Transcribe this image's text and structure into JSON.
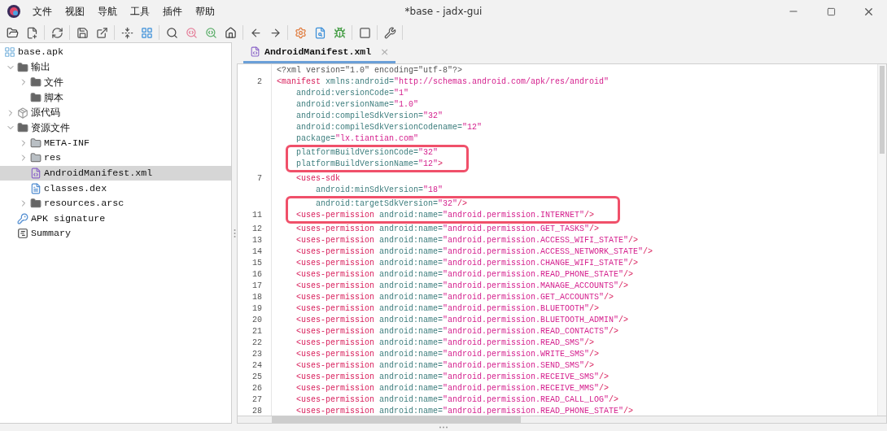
{
  "window": {
    "title": "*base - jadx-gui"
  },
  "menu": [
    "文件",
    "视图",
    "导航",
    "工具",
    "插件",
    "帮助"
  ],
  "tree": [
    {
      "label": "base.apk",
      "kind": "apk",
      "selected": false,
      "children": [
        {
          "label": "输出",
          "kind": "output",
          "selected": false,
          "expanded": true,
          "children": [
            {
              "label": "文件",
              "kind": "files",
              "selected": false,
              "expanded": false
            },
            {
              "label": "脚本",
              "kind": "scripts",
              "selected": false
            }
          ]
        },
        {
          "label": "源代码",
          "kind": "package",
          "selected": false,
          "expanded": false
        },
        {
          "label": "资源文件",
          "kind": "resources",
          "selected": false,
          "expanded": true,
          "children": [
            {
              "label": "META-INF",
              "kind": "folder",
              "selected": false,
              "expanded": false
            },
            {
              "label": "res",
              "kind": "folder",
              "selected": false,
              "expanded": false
            },
            {
              "label": "AndroidManifest.xml",
              "kind": "manifest",
              "selected": true
            },
            {
              "label": "classes.dex",
              "kind": "dex",
              "selected": false
            },
            {
              "label": "resources.arsc",
              "kind": "arsc",
              "selected": false,
              "expanded": false
            }
          ]
        },
        {
          "label": "APK signature",
          "kind": "signature",
          "selected": false
        },
        {
          "label": "Summary",
          "kind": "summary",
          "selected": false
        }
      ]
    }
  ],
  "tabs": [
    {
      "label": "AndroidManifest.xml",
      "selected": true,
      "close": "×"
    }
  ],
  "code": [
    {
      "tokens": [
        {
          "kind": "plain",
          "text": "<?xml version=\"1.0\" encoding=\"utf-8\"?>"
        }
      ]
    },
    {
      "number": "2",
      "tokens": [
        {
          "kind": "tag",
          "text": "<manifest"
        },
        {
          "kind": "attr",
          "text": " xmlns:android="
        },
        {
          "kind": "value",
          "text": "\"http://schemas.android.com/apk/res/android\""
        }
      ]
    },
    {
      "tokens": [
        {
          "kind": "attr",
          "text": "    android:versionCode="
        },
        {
          "kind": "value",
          "text": "\"1\""
        }
      ]
    },
    {
      "tokens": [
        {
          "kind": "attr",
          "text": "    android:versionName="
        },
        {
          "kind": "value",
          "text": "\"1.0\""
        }
      ]
    },
    {
      "tokens": [
        {
          "kind": "attr",
          "text": "    android:compileSdkVersion="
        },
        {
          "kind": "value",
          "text": "\"32\""
        }
      ]
    },
    {
      "tokens": [
        {
          "kind": "attr",
          "text": "    android:compileSdkVersionCodename="
        },
        {
          "kind": "value",
          "text": "\"12\""
        }
      ]
    },
    {
      "tokens": [
        {
          "kind": "attr",
          "text": "    package="
        },
        {
          "kind": "value",
          "text": "\"lx.tiantian.com\""
        }
      ]
    },
    {
      "boxed": true,
      "tokens": [
        {
          "kind": "attr",
          "text": "    platformBuildVersionCode="
        },
        {
          "kind": "value",
          "text": "\"32\""
        }
      ]
    },
    {
      "boxed": true,
      "tokens": [
        {
          "kind": "attr",
          "text": "    platformBuildVersionName="
        },
        {
          "kind": "value",
          "text": "\"12\""
        },
        {
          "kind": "tag",
          "text": ">"
        }
      ]
    },
    {
      "number": "7",
      "tokens": [
        {
          "kind": "tag",
          "text": "    <uses-sdk"
        }
      ]
    },
    {
      "tokens": [
        {
          "kind": "attr",
          "text": "        android:minSdkVersion="
        },
        {
          "kind": "value",
          "text": "\"18\""
        }
      ]
    },
    {
      "boxed": true,
      "tokens": [
        {
          "kind": "attr",
          "text": "        android:targetSdkVersion="
        },
        {
          "kind": "value",
          "text": "\"32\""
        },
        {
          "kind": "tag",
          "text": "/>"
        }
      ]
    },
    {
      "number": "11",
      "boxed": true,
      "tokens": [
        {
          "kind": "tag",
          "text": "    <uses-permission"
        },
        {
          "kind": "attr",
          "text": " android:name="
        },
        {
          "kind": "value",
          "text": "\"android.permission.INTERNET\""
        },
        {
          "kind": "tag",
          "text": "/>"
        }
      ]
    },
    {
      "number": "12",
      "tokens": [
        {
          "kind": "tag",
          "text": "    <uses-permission"
        },
        {
          "kind": "attr",
          "text": " android:name="
        },
        {
          "kind": "value",
          "text": "\"android.permission.GET_TASKS\""
        },
        {
          "kind": "tag",
          "text": "/>"
        }
      ]
    },
    {
      "number": "13",
      "tokens": [
        {
          "kind": "tag",
          "text": "    <uses-permission"
        },
        {
          "kind": "attr",
          "text": " android:name="
        },
        {
          "kind": "value",
          "text": "\"android.permission.ACCESS_WIFI_STATE\""
        },
        {
          "kind": "tag",
          "text": "/>"
        }
      ]
    },
    {
      "number": "14",
      "tokens": [
        {
          "kind": "tag",
          "text": "    <uses-permission"
        },
        {
          "kind": "attr",
          "text": " android:name="
        },
        {
          "kind": "value",
          "text": "\"android.permission.ACCESS_NETWORK_STATE\""
        },
        {
          "kind": "tag",
          "text": "/>"
        }
      ]
    },
    {
      "number": "15",
      "tokens": [
        {
          "kind": "tag",
          "text": "    <uses-permission"
        },
        {
          "kind": "attr",
          "text": " android:name="
        },
        {
          "kind": "value",
          "text": "\"android.permission.CHANGE_WIFI_STATE\""
        },
        {
          "kind": "tag",
          "text": "/>"
        }
      ]
    },
    {
      "number": "16",
      "tokens": [
        {
          "kind": "tag",
          "text": "    <uses-permission"
        },
        {
          "kind": "attr",
          "text": " android:name="
        },
        {
          "kind": "value",
          "text": "\"android.permission.READ_PHONE_STATE\""
        },
        {
          "kind": "tag",
          "text": "/>"
        }
      ]
    },
    {
      "number": "17",
      "tokens": [
        {
          "kind": "tag",
          "text": "    <uses-permission"
        },
        {
          "kind": "attr",
          "text": " android:name="
        },
        {
          "kind": "value",
          "text": "\"android.permission.MANAGE_ACCOUNTS\""
        },
        {
          "kind": "tag",
          "text": "/>"
        }
      ]
    },
    {
      "number": "18",
      "tokens": [
        {
          "kind": "tag",
          "text": "    <uses-permission"
        },
        {
          "kind": "attr",
          "text": " android:name="
        },
        {
          "kind": "value",
          "text": "\"android.permission.GET_ACCOUNTS\""
        },
        {
          "kind": "tag",
          "text": "/>"
        }
      ]
    },
    {
      "number": "19",
      "tokens": [
        {
          "kind": "tag",
          "text": "    <uses-permission"
        },
        {
          "kind": "attr",
          "text": " android:name="
        },
        {
          "kind": "value",
          "text": "\"android.permission.BLUETOOTH\""
        },
        {
          "kind": "tag",
          "text": "/>"
        }
      ]
    },
    {
      "number": "20",
      "tokens": [
        {
          "kind": "tag",
          "text": "    <uses-permission"
        },
        {
          "kind": "attr",
          "text": " android:name="
        },
        {
          "kind": "value",
          "text": "\"android.permission.BLUETOOTH_ADMIN\""
        },
        {
          "kind": "tag",
          "text": "/>"
        }
      ]
    },
    {
      "number": "21",
      "tokens": [
        {
          "kind": "tag",
          "text": "    <uses-permission"
        },
        {
          "kind": "attr",
          "text": " android:name="
        },
        {
          "kind": "value",
          "text": "\"android.permission.READ_CONTACTS\""
        },
        {
          "kind": "tag",
          "text": "/>"
        }
      ]
    },
    {
      "number": "22",
      "tokens": [
        {
          "kind": "tag",
          "text": "    <uses-permission"
        },
        {
          "kind": "attr",
          "text": " android:name="
        },
        {
          "kind": "value",
          "text": "\"android.permission.READ_SMS\""
        },
        {
          "kind": "tag",
          "text": "/>"
        }
      ]
    },
    {
      "number": "23",
      "tokens": [
        {
          "kind": "tag",
          "text": "    <uses-permission"
        },
        {
          "kind": "attr",
          "text": " android:name="
        },
        {
          "kind": "value",
          "text": "\"android.permission.WRITE_SMS\""
        },
        {
          "kind": "tag",
          "text": "/>"
        }
      ]
    },
    {
      "number": "24",
      "tokens": [
        {
          "kind": "tag",
          "text": "    <uses-permission"
        },
        {
          "kind": "attr",
          "text": " android:name="
        },
        {
          "kind": "value",
          "text": "\"android.permission.SEND_SMS\""
        },
        {
          "kind": "tag",
          "text": "/>"
        }
      ]
    },
    {
      "number": "25",
      "tokens": [
        {
          "kind": "tag",
          "text": "    <uses-permission"
        },
        {
          "kind": "attr",
          "text": " android:name="
        },
        {
          "kind": "value",
          "text": "\"android.permission.RECEIVE_SMS\""
        },
        {
          "kind": "tag",
          "text": "/>"
        }
      ]
    },
    {
      "number": "26",
      "tokens": [
        {
          "kind": "tag",
          "text": "    <uses-permission"
        },
        {
          "kind": "attr",
          "text": " android:name="
        },
        {
          "kind": "value",
          "text": "\"android.permission.RECEIVE_MMS\""
        },
        {
          "kind": "tag",
          "text": "/>"
        }
      ]
    },
    {
      "number": "27",
      "tokens": [
        {
          "kind": "tag",
          "text": "    <uses-permission"
        },
        {
          "kind": "attr",
          "text": " android:name="
        },
        {
          "kind": "value",
          "text": "\"android.permission.READ_CALL_LOG\""
        },
        {
          "kind": "tag",
          "text": "/>"
        }
      ]
    },
    {
      "number": "28",
      "tokens": [
        {
          "kind": "tag",
          "text": "    <uses-permission"
        },
        {
          "kind": "attr",
          "text": " android:name="
        },
        {
          "kind": "value",
          "text": "\"android.permission.READ_PHONE_STATE\""
        },
        {
          "kind": "tag",
          "text": "/>"
        }
      ]
    }
  ]
}
